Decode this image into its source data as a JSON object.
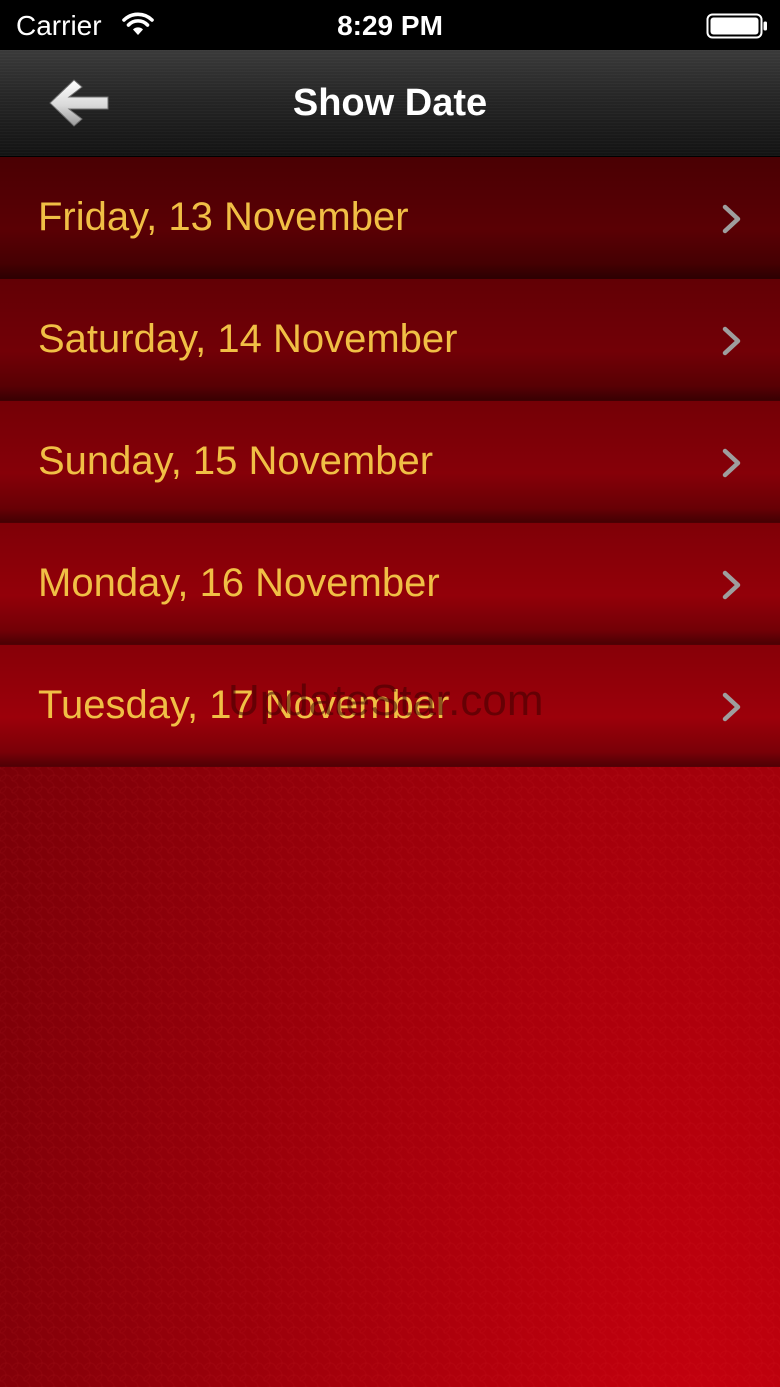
{
  "status_bar": {
    "carrier": "Carrier",
    "time": "8:29 PM",
    "wifi_icon": "wifi-icon",
    "battery_icon": "battery-full-icon"
  },
  "nav": {
    "title": "Show Date",
    "back_icon": "back-arrow-icon"
  },
  "dates": [
    {
      "label": "Friday, 13 November",
      "icon": "chevron-right-icon"
    },
    {
      "label": "Saturday, 14 November",
      "icon": "chevron-right-icon"
    },
    {
      "label": "Sunday, 15 November",
      "icon": "chevron-right-icon"
    },
    {
      "label": "Monday, 16 November",
      "icon": "chevron-right-icon"
    },
    {
      "label": "Tuesday, 17 November",
      "icon": "chevron-right-icon"
    }
  ],
  "watermark": "UpdateStar.com",
  "colors": {
    "label_gold": "#f0bf45",
    "background_red": "#a3000b",
    "nav_dark": "#262626"
  }
}
